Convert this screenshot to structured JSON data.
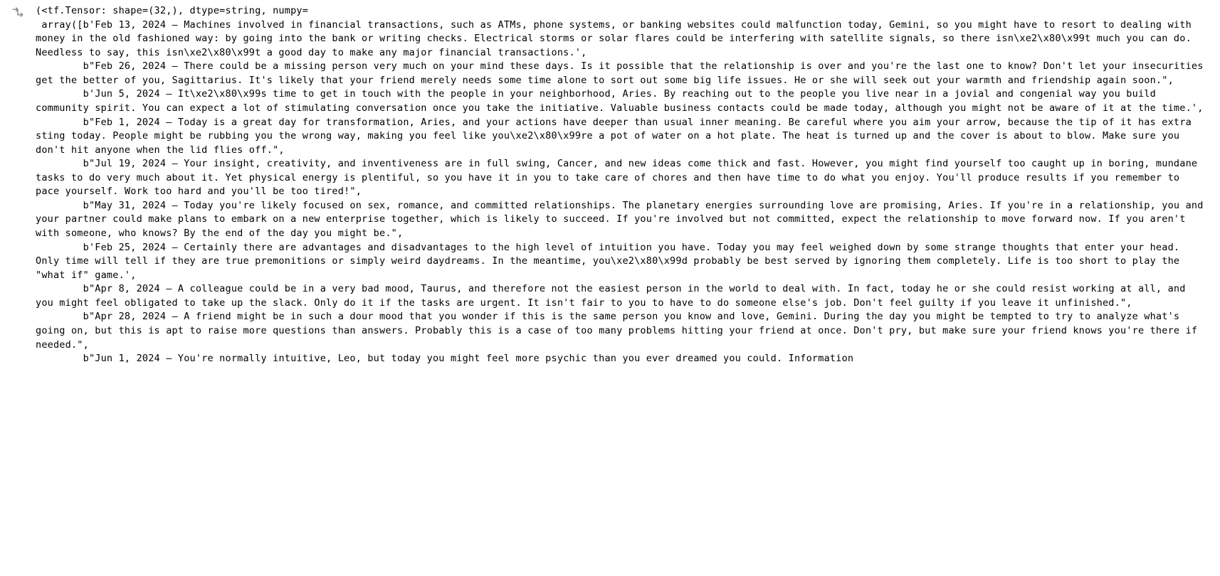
{
  "output": {
    "header": "(<tf.Tensor: shape=(32,), dtype=string, numpy=",
    "array_open": "array([",
    "entries": [
      "b'Feb 13, 2024 – Machines involved in financial transactions, such as ATMs, phone systems, or banking websites could malfunction today, Gemini, so you might have to resort to dealing with money in the old fashioned way: by going into the bank or writing checks. Electrical storms or solar flares could be interfering with satellite signals, so there isn\\xe2\\x80\\x99t much you can do. Needless to say, this isn\\xe2\\x80\\x99t a good day to make any major financial transactions.',",
      "b\"Feb 26, 2024 – There could be a missing person very much on your mind these days. Is it possible that the relationship is over and you're the last one to know? Don't let your insecurities get the better of you, Sagittarius. It's likely that your friend merely needs some time alone to sort out some big life issues. He or she will seek out your warmth and friendship again soon.\",",
      "b'Jun 5, 2024 – It\\xe2\\x80\\x99s time to get in touch with the people in your neighborhood, Aries. By reaching out to the people you live near in a jovial and congenial way you build community spirit. You can expect a lot of stimulating conversation once you take the initiative. Valuable business contacts could be made today, although you might not be aware of it at the time.',",
      "b\"Feb 1, 2024 – Today is a great day for transformation, Aries, and your actions have deeper than usual inner meaning. Be careful where you aim your arrow, because the tip of it has extra sting today. People might be rubbing you the wrong way, making you feel like you\\xe2\\x80\\x99re a pot of water on a hot plate. The heat is turned up and the cover is about to blow. Make sure you don't hit anyone when the lid flies off.\",",
      "b\"Jul 19, 2024 – Your insight, creativity, and inventiveness are in full swing, Cancer, and new ideas come thick and fast. However, you might find yourself too caught up in boring, mundane tasks to do very much about it. Yet physical energy is plentiful, so you have it in you to take care of chores and then have time to do what you enjoy. You'll produce results if you remember to pace yourself. Work too hard and you'll be too tired!\",",
      "b\"May 31, 2024 – Today you're likely focused on sex, romance, and committed relationships. The planetary energies surrounding love are promising, Aries. If you're in a relationship, you and your partner could make plans to embark on a new enterprise together, which is likely to succeed. If you're involved but not committed, expect the relationship to move forward now. If you aren't with someone, who knows? By the end of the day you might be.\",",
      "b'Feb 25, 2024 – Certainly there are advantages and disadvantages to the high level of intuition you have. Today you may feel weighed down by some strange thoughts that enter your head. Only time will tell if they are true premonitions or simply weird daydreams. In the meantime, you\\xe2\\x80\\x99d probably be best served by ignoring them completely. Life is too short to play the \"what if\" game.',",
      "b\"Apr 8, 2024 – A colleague could be in a very bad mood, Taurus, and therefore not the easiest person in the world to deal with. In fact, today he or she could resist working at all, and you might feel obligated to take up the slack. Only do it if the tasks are urgent. It isn't fair to you to have to do someone else's job. Don't feel guilty if you leave it unfinished.\",",
      "b\"Apr 28, 2024 – A friend might be in such a dour mood that you wonder if this is the same person you know and love, Gemini. During the day you might be tempted to try to analyze what's going on, but this is apt to raise more questions than answers. Probably this is a case of too many problems hitting your friend at once. Don't pry, but make sure your friend knows you're there if needed.\",",
      "b\"Jun 1, 2024 – You're normally intuitive, Leo, but today you might feel more psychic than you ever dreamed you could. Information"
    ]
  }
}
